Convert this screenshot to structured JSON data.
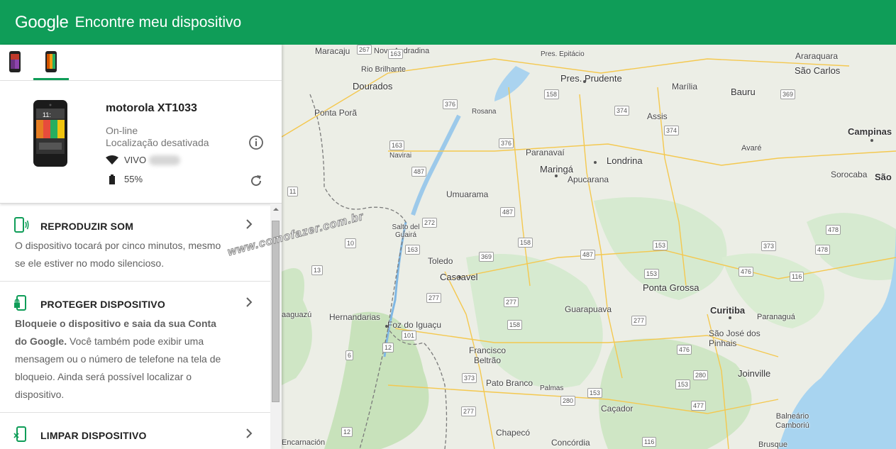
{
  "header": {
    "brand": "Google",
    "title": "Encontre meu dispositivo"
  },
  "devices": [
    {
      "icon": "phone-purple-icon"
    },
    {
      "icon": "phone-red-icon",
      "active": true
    }
  ],
  "device": {
    "name": "motorola XT1033",
    "status": "On-line",
    "location": "Localização desativada",
    "network": "VIVO",
    "battery": "55%"
  },
  "actions": [
    {
      "title": "REPRODUZIR SOM",
      "desc": "O dispositivo tocará por cinco minutos, mesmo se ele estiver no modo silencioso."
    },
    {
      "title": "PROTEGER DISPOSITIVO",
      "desc_bold": "Bloqueie o dispositivo e saia da sua Conta do Google.",
      "desc": " Você também pode exibir uma mensagem ou o número de telefone na tela de bloqueio. Ainda será possível localizar o dispositivo."
    },
    {
      "title": "LIMPAR DISPOSITIVO"
    }
  ],
  "watermark": "www.comofazer.com.br",
  "map": {
    "cities": [
      "Maracaju",
      "Nova Andradina",
      "Rio Brilhante",
      "Dourados",
      "Ponta Porã",
      "Pres. Prudente",
      "Pres. Epitácio",
      "Araraquara",
      "São Carlos",
      "Marília",
      "Bauru",
      "Assis",
      "Campinas",
      "Paranavaí",
      "Londrina",
      "Maringá",
      "Apucarana",
      "Avaré",
      "Sorocaba",
      "São",
      "Umuarama",
      "Navirai",
      "Rosana",
      "Salto del Guairá",
      "Toledo",
      "Cascavel",
      "Ponta Grossa",
      "Curitiba",
      "São José dos Pinhais",
      "Paranaguá",
      "Guarapuava",
      "Hernandarias",
      "Foz do Iguaçu",
      "Francisco Beltrão",
      "Pato Branco",
      "Palmas",
      "Caçador",
      "Joinville",
      "Balneário Camboriú",
      "Chapecó",
      "Concórdia",
      "Encarnación",
      "Brusque",
      "aaguazú"
    ],
    "roads": [
      "267",
      "163",
      "376",
      "158",
      "374",
      "374",
      "369",
      "487",
      "163",
      "376",
      "487",
      "272",
      "10",
      "163",
      "369",
      "158",
      "487",
      "153",
      "476",
      "478",
      "373",
      "478",
      "116",
      "153",
      "11",
      "13",
      "277",
      "277",
      "158",
      "277",
      "277",
      "12",
      "101",
      "6",
      "153",
      "373",
      "280",
      "153",
      "477",
      "116",
      "476",
      "280",
      "101",
      "12",
      "116"
    ]
  }
}
